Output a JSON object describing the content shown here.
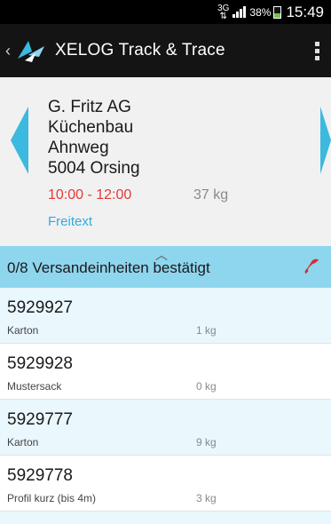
{
  "status_bar": {
    "network": "3G",
    "battery_percent": "38%",
    "time": "15:49"
  },
  "action_bar": {
    "title": "XELOG Track & Trace",
    "logo_icon": "bird-logo-icon",
    "menu_icon": "overflow-menu-icon"
  },
  "stop": {
    "company": "G. Fritz AG",
    "department": "Küchenbau",
    "street": "Ahnweg",
    "city": "5004 Orsing",
    "time_window": "10:00 - 12:00",
    "total_weight": "37 kg",
    "freitext_link": "Freitext"
  },
  "confirmation": {
    "label": "0/8 Versandeinheiten bestätigt",
    "phone_icon": "phone-icon"
  },
  "units": [
    {
      "id": "5929927",
      "type": "Karton",
      "weight": "1 kg"
    },
    {
      "id": "5929928",
      "type": "Mustersack",
      "weight": "0 kg"
    },
    {
      "id": "5929777",
      "type": "Karton",
      "weight": "9 kg"
    },
    {
      "id": "5929778",
      "type": "Profil kurz (bis 4m)",
      "weight": "3 kg"
    }
  ],
  "colors": {
    "accent": "#3bb9df",
    "time_window": "#e53935",
    "confirm_bar": "#8ed5ee",
    "phone": "#d32f2f"
  }
}
